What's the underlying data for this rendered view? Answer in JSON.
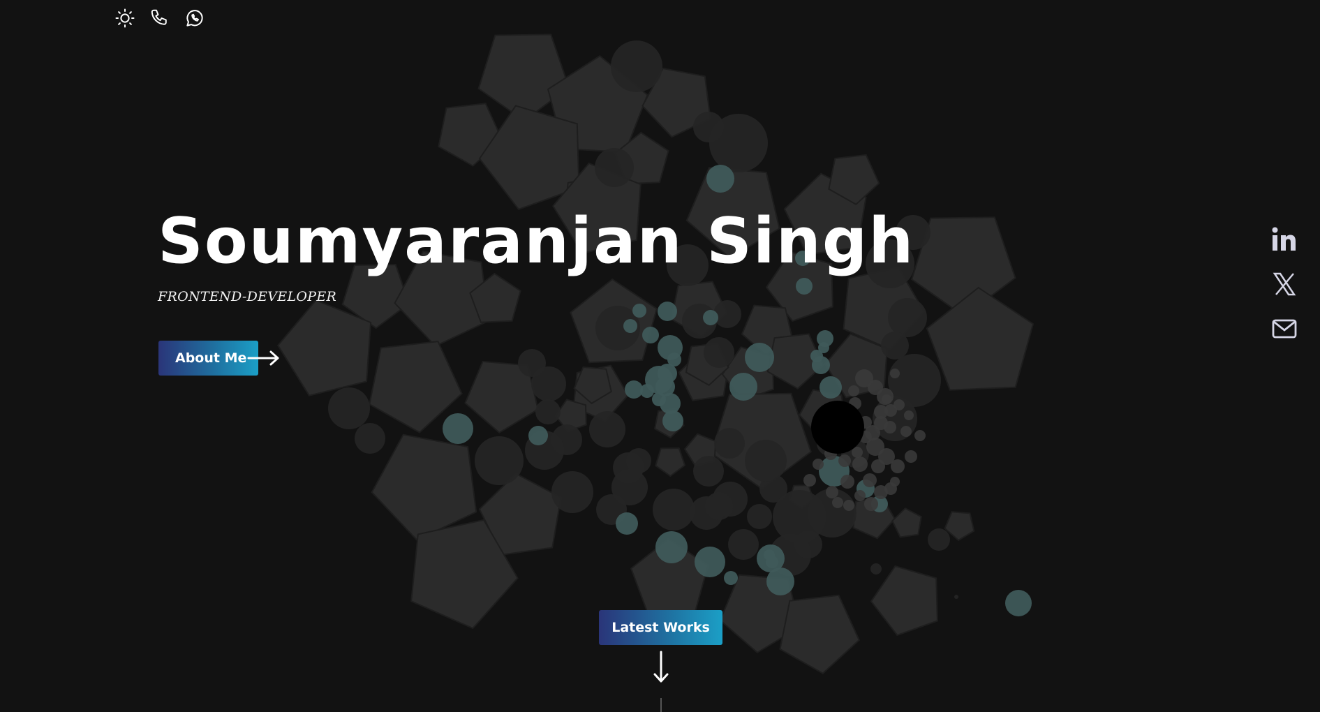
{
  "header": {
    "icons": [
      "sun-icon",
      "phone-icon",
      "whatsapp-icon"
    ]
  },
  "hero": {
    "name": "Soumyaranjan Singh",
    "role": "FRONTEND-DEVELOPER",
    "about_button": "About Me"
  },
  "social": {
    "icons": [
      "linkedin-icon",
      "x-icon",
      "mail-icon"
    ]
  },
  "footer_nav": {
    "latest_works_button": "Latest Works"
  },
  "colors": {
    "background": "#121212",
    "button_gradient_start": "#2a3579",
    "button_gradient_end": "#1b9fc6",
    "shape_fill": "#2b2b2b",
    "bubble_fill": "#3f5a5a"
  }
}
